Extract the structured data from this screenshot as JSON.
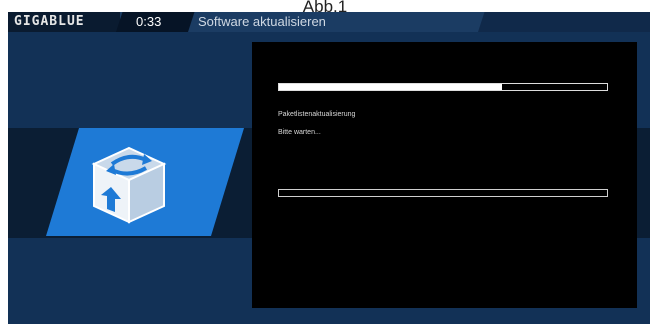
{
  "caption": "Abb.1",
  "header": {
    "logo": "GIGABLUE",
    "clock": "0:33",
    "title": "Software aktualisieren"
  },
  "icon": {
    "name": "software-update-box-icon"
  },
  "dialog": {
    "progress_fraction": 0.68,
    "status_line_1": "Paketlistenaktualisierung",
    "status_line_2": "Bitte warten...",
    "lower_progress_fraction": 0.0
  },
  "colors": {
    "background": "#123156",
    "accent": "#1e7ad6",
    "dialog": "#000000"
  }
}
